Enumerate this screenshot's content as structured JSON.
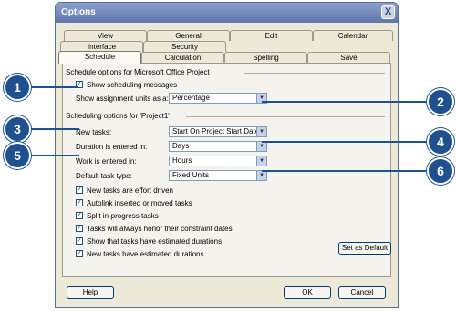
{
  "window": {
    "title": "Options",
    "close_glyph": "X"
  },
  "tabs": {
    "row1": [
      "View",
      "General",
      "Edit",
      "Calendar"
    ],
    "row2": [
      "Interface",
      "Security"
    ],
    "row3": [
      "Schedule",
      "Calculation",
      "Spelling",
      "Save"
    ],
    "active": "Schedule"
  },
  "section1": {
    "title": "Schedule options for Microsoft Office Project",
    "show_messages": {
      "label": "Show scheduling messages",
      "checked": true
    },
    "assignment_units": {
      "label": "Show assignment units as a:",
      "value": "Percentage"
    }
  },
  "section2": {
    "title": "Scheduling options for 'Project1'",
    "new_tasks": {
      "label": "New tasks:",
      "value": "Start On Project Start Date"
    },
    "duration": {
      "label": "Duration is entered in:",
      "value": "Days"
    },
    "work": {
      "label": "Work is entered in:",
      "value": "Hours"
    },
    "task_type": {
      "label": "Default task type:",
      "value": "Fixed Units"
    },
    "checkboxes": [
      {
        "label": "New tasks are effort driven",
        "checked": true
      },
      {
        "label": "Autolink inserted or moved tasks",
        "checked": true
      },
      {
        "label": "Split in-progress tasks",
        "checked": true
      },
      {
        "label": "Tasks will always honor their constraint dates",
        "checked": true
      },
      {
        "label": "Show that tasks have estimated durations",
        "checked": true
      },
      {
        "label": "New tasks have estimated durations",
        "checked": true
      }
    ],
    "set_default": "Set as Default"
  },
  "buttons": {
    "help": "Help",
    "ok": "OK",
    "cancel": "Cancel"
  },
  "callouts": [
    "1",
    "2",
    "3",
    "4",
    "5",
    "6"
  ],
  "colors": {
    "callout": "#1f5191",
    "titlebar": "#6f84b7",
    "dialog": "#ece9d8"
  }
}
